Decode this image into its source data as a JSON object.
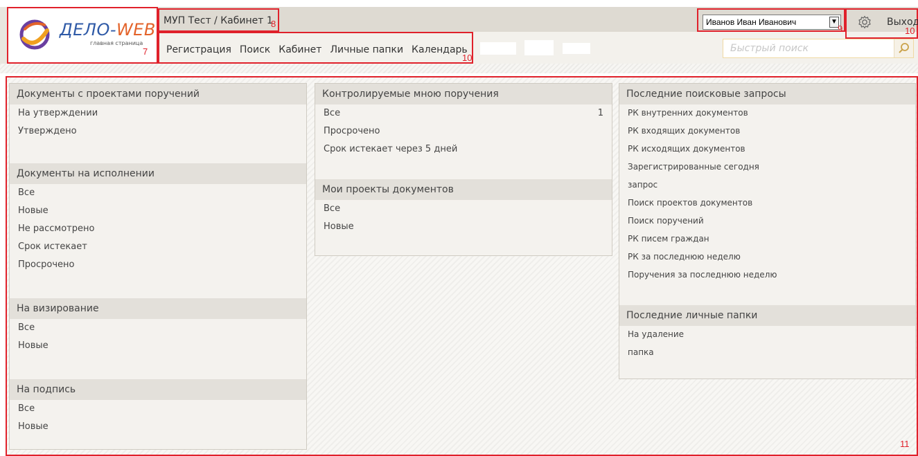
{
  "logo": {
    "brand_main": "ДЕЛО-",
    "brand_accent": "WEB",
    "subtitle": "главная страница"
  },
  "header": {
    "breadcrumb": "МУП Тест / Кабинет 1",
    "nav": [
      "Регистрация",
      "Поиск",
      "Кабинет",
      "Личные папки",
      "Календарь"
    ],
    "user_selected": "Иванов Иван Иванович",
    "logout_label": "Выход",
    "quick_search_placeholder": "Быстрый поиск"
  },
  "callouts": {
    "logo": "7",
    "breadcrumb": "8",
    "user": "9",
    "nav": "10",
    "logout": "10",
    "content": "11"
  },
  "colors": {
    "callout_red": "#e0212b",
    "brand_blue": "#2f5aa7",
    "brand_orange": "#e3632a"
  },
  "icons": {
    "gear": "gear-icon",
    "search": "search-icon",
    "dropdown": "chevron-down-icon",
    "logo": "logo-ring-icon"
  },
  "columns": {
    "left": [
      {
        "title": "Документы с проектами поручений",
        "items": [
          "На утверждении",
          "Утверждено"
        ]
      },
      {
        "title": "Документы на исполнении",
        "items": [
          "Все",
          "Новые",
          "Не рассмотрено",
          "Срок истекает",
          "Просрочено"
        ]
      },
      {
        "title": "На визирование",
        "items": [
          "Все",
          "Новые"
        ]
      },
      {
        "title": "На подпись",
        "items": [
          "Все",
          "Новые"
        ]
      }
    ],
    "middle": [
      {
        "title": "Контролируемые мною поручения",
        "items": [
          "Все",
          "Просрочено",
          "Срок истекает через 5 дней"
        ],
        "counts": [
          "1",
          "",
          ""
        ]
      },
      {
        "title": "Мои проекты документов",
        "items": [
          "Все",
          "Новые"
        ]
      }
    ],
    "right": [
      {
        "title": "Последние поисковые запросы",
        "items": [
          "РК внутренних документов",
          "РК входящих документов",
          "РК исходящих документов",
          "Зарегистрированные сегодня",
          "запрос",
          "Поиск проектов документов",
          "Поиск поручений",
          "РК писем граждан",
          "РК за последнюю неделю",
          "Поручения за последнюю неделю"
        ]
      },
      {
        "title": "Последние личные папки",
        "items": [
          "На удаление",
          "папка"
        ]
      }
    ]
  }
}
